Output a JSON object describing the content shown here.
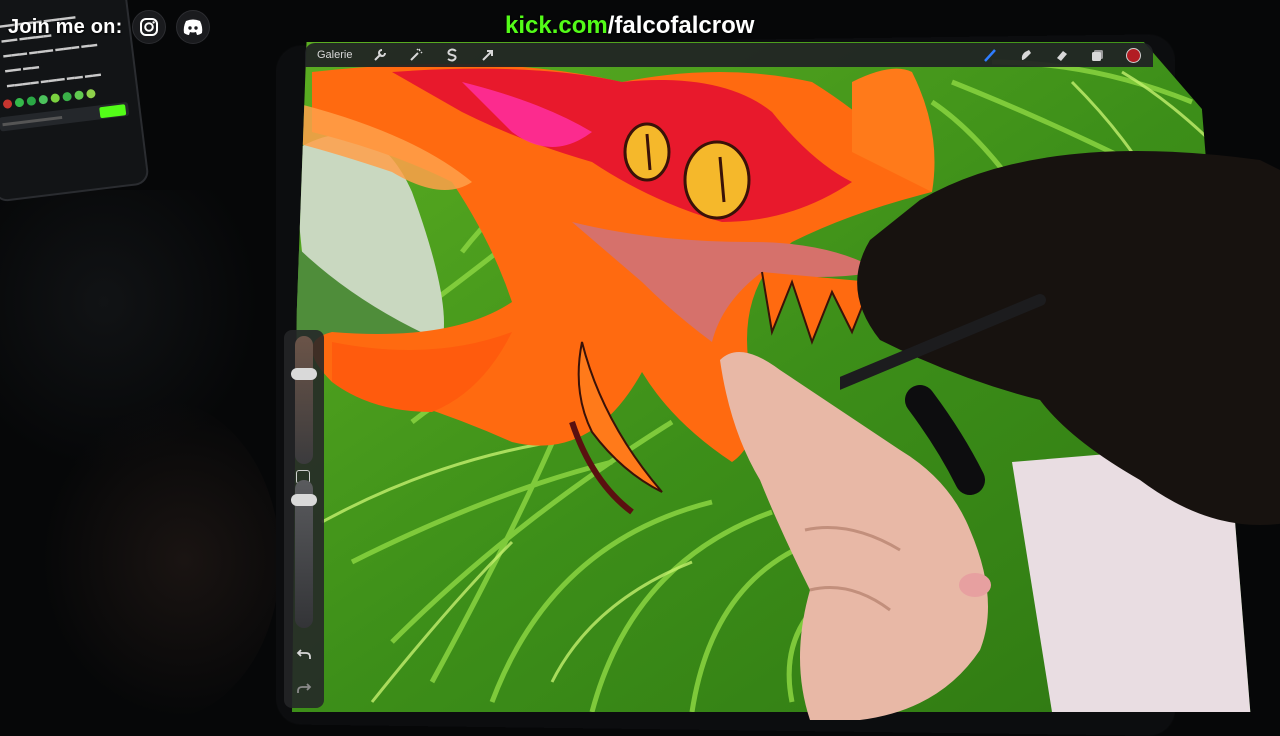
{
  "overlay": {
    "join_label": "Join me on:",
    "kick_domain": "kick.com",
    "kick_channel": "/falcofalcrow",
    "social_icons": [
      "instagram-icon",
      "discord-icon"
    ],
    "kick_color": "#53fc18"
  },
  "procreate": {
    "gallery_label": "Galerie",
    "left_tools": [
      "wrench-icon",
      "magic-wand-icon",
      "selection-icon",
      "transform-arrow-icon"
    ],
    "right_tools": [
      "brush-icon",
      "smudge-icon",
      "eraser-icon",
      "layers-icon"
    ],
    "current_color": "#b21d23",
    "sidebar": {
      "brush_size_level": 0.72,
      "opacity_level": 0.9,
      "undo_icon": "undo-icon",
      "redo_icon": "redo-icon"
    }
  },
  "colors": {
    "dragon_red": "#e8192c",
    "dragon_orange": "#ff6a10",
    "dragon_eye": "#f5b82b",
    "leaf_green": "#4aa31c"
  }
}
